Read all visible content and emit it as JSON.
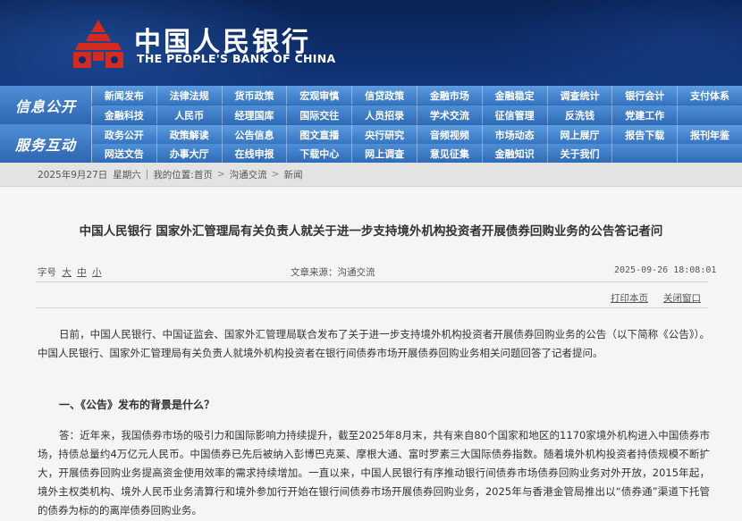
{
  "header": {
    "logo_cn": "中国人民银行",
    "logo_en": "THE PEOPLE'S BANK OF CHINA"
  },
  "nav": {
    "section1": "信息公开",
    "section2": "服务互动",
    "rows": [
      [
        "新闻发布",
        "法律法规",
        "货币政策",
        "宏观审慎",
        "信贷政策",
        "金融市场",
        "金融稳定",
        "调查统计",
        "银行会计",
        "支付体系"
      ],
      [
        "金融科技",
        "人民币",
        "经理国库",
        "国际交往",
        "人员招录",
        "学术交流",
        "征信管理",
        "反洗钱",
        "党建工作",
        ""
      ],
      [
        "政务公开",
        "政策解读",
        "公告信息",
        "图文直播",
        "央行研究",
        "音频视频",
        "市场动态",
        "网上展厅",
        "报告下载",
        "报刊年鉴"
      ],
      [
        "网送文告",
        "办事大厅",
        "在线申报",
        "下载中心",
        "网上调查",
        "意见征集",
        "金融知识",
        "关于我们",
        "",
        ""
      ]
    ]
  },
  "breadcrumb": {
    "date": "2025年9月27日",
    "weekday": "星期六",
    "location_label": "我的位置:首页",
    "item1": "沟通交流",
    "item2": "新闻"
  },
  "article": {
    "title": "中国人民银行  国家外汇管理局有关负责人就关于进一步支持境外机构投资者开展债券回购业务的公告答记者问",
    "font_label": "字号",
    "font_large": "大",
    "font_medium": "中",
    "font_small": "小",
    "source": "文章来源：沟通交流",
    "datetime": "2025-09-26  18:08:01",
    "print_link": "打印本页",
    "close_link": "关闭窗口",
    "para1": "日前，中国人民银行、中国证监会、国家外汇管理局联合发布了关于进一步支持境外机构投资者开展债券回购业务的公告（以下简称《公告》）。中国人民银行、国家外汇管理局有关负责人就境外机构投资者在银行间债券市场开展债券回购业务相关问题回答了记者提问。",
    "heading1": "一、《公告》发布的背景是什么？",
    "para2": "答：近年来，我国债券市场的吸引力和国际影响力持续提升，截至2025年8月末，共有来自80个国家和地区的1170家境外机构进入中国债券市场，持债总量约4万亿元人民币。中国债券已先后被纳入彭博巴克莱、摩根大通、富时罗素三大国际债券指数。随着境外机构投资者持债规模不断扩大，开展债券回购业务提高资金使用效率的需求持续增加。一直以来，中国人民银行有序推动银行间债券市场债券回购业务对外开放，2015年起，境外主权类机构、境外人民币业务清算行和境外参加行开始在银行间债券市场开展债券回购业务，2025年与香港金管局推出以“债券通”渠道下托管的债券为标的的离岸债券回购业务。"
  }
}
